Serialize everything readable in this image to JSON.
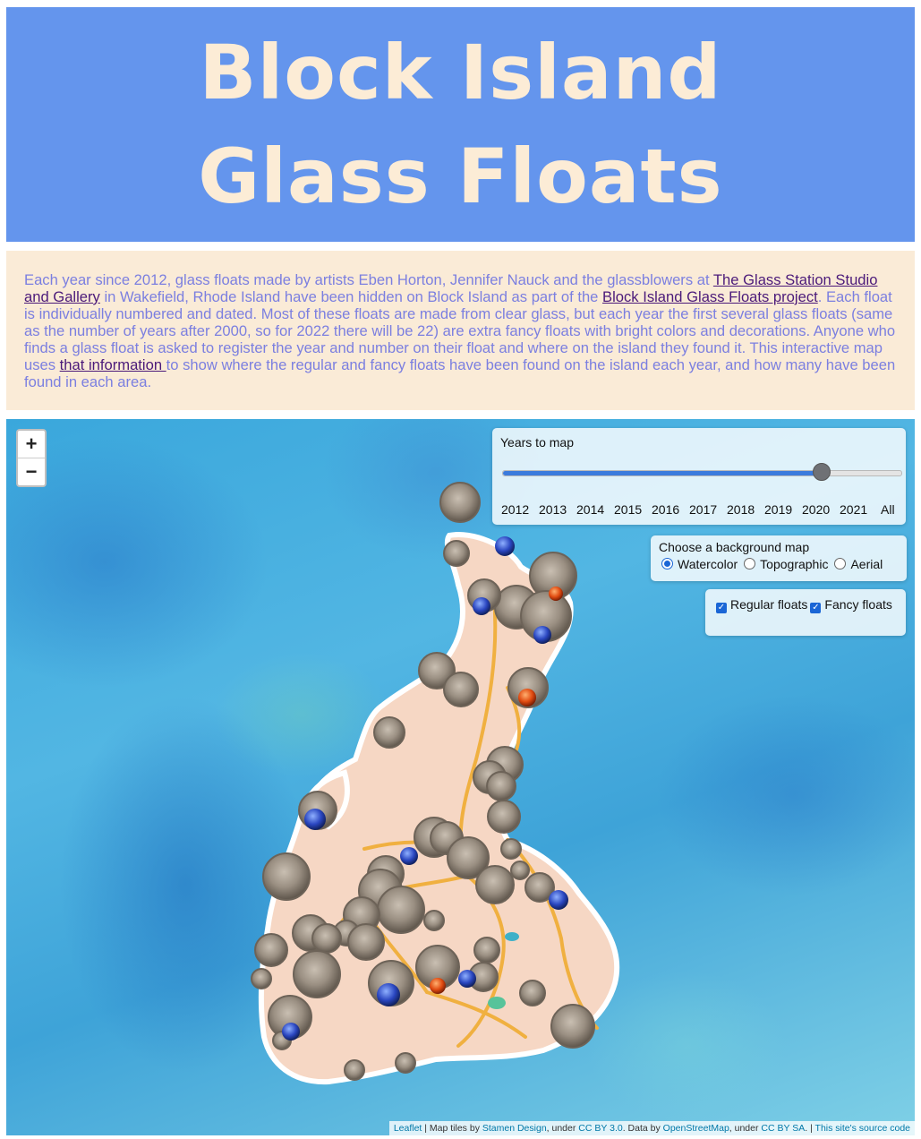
{
  "header": {
    "title": "Block Island Glass Floats"
  },
  "intro": {
    "t1": "Each year since 2012, glass floats made by artists Eben Horton, Jennifer Nauck and the glassblowers at ",
    "link1": "The Glass Station Studio and Gallery",
    "t2": " in Wakefield, Rhode Island have been hidden on Block Island as part of the ",
    "link2": "Block Island Glass Floats project",
    "t3": ". Each float is individually numbered and dated. Most of these floats are made from clear glass, but each year the first several glass floats (same as the number of years after 2000, so for 2022 there will be 22) are extra fancy floats with bright colors and decorations. Anyone who finds a glass float is asked to register the year and number on their float and where on the island they found it. This interactive map uses ",
    "link3": "that information ",
    "t4": "to show where the regular and fancy floats have been found on the island each year, and how many have been found in each area."
  },
  "map": {
    "zoom_in": "+",
    "zoom_out": "−",
    "years_label": "Years to map",
    "years": [
      "2012",
      "2013",
      "2014",
      "2015",
      "2016",
      "2017",
      "2018",
      "2019",
      "2020",
      "2021",
      "All"
    ],
    "selected_year": "2020",
    "slider_fraction": 0.8,
    "bg_label": "Choose a background map",
    "bg_options": [
      "Watercolor",
      "Topographic",
      "Aerial"
    ],
    "bg_selected": "Watercolor",
    "float_types": [
      "Regular floats",
      "Fancy floats"
    ],
    "attribution": {
      "leaflet": "Leaflet",
      "t1": " | Map tiles by ",
      "stamen": "Stamen Design",
      "t2": ", under ",
      "ccby": "CC BY 3.0",
      "t3": ". Data by ",
      "osm": "OpenStreetMap",
      "t4": ", under ",
      "ccbysa": "CC BY SA",
      "t5": ". | ",
      "source": "This site's source code"
    }
  },
  "colors": {
    "header_bg": "#6495ed",
    "title": "#fcecd6",
    "intro_bg": "#faebd7",
    "intro_text": "#7b7fe0",
    "link": "#4b1a7a",
    "island": "#f6d7c4",
    "road": "#f0b040"
  }
}
